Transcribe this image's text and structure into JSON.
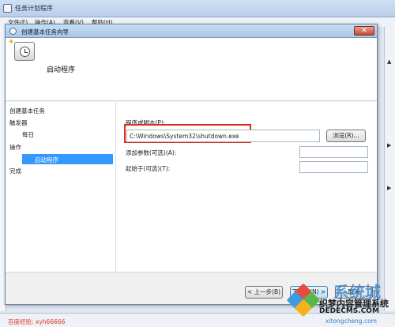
{
  "bg": {
    "title": "任务计划程序",
    "menu": [
      "文件(F)",
      "操作(A)",
      "查看(V)",
      "帮助(H)"
    ],
    "watermark_left": "百度经验: xyh66666"
  },
  "dialog": {
    "title": "创建基本任务向导",
    "close_label": "✕",
    "header_title": "启动程序",
    "nav": [
      {
        "label": "创建基本任务"
      },
      {
        "label": "触发器"
      },
      {
        "label": "每日"
      },
      {
        "label": "操作"
      },
      {
        "label": "启动程序",
        "selected": true
      },
      {
        "label": "完成"
      }
    ],
    "program_label": "程序或脚本(P):",
    "program_value": "C:\\Windows\\System32\\shutdown.exe",
    "browse_label": "浏览(R)...",
    "args_label": "添加参数(可选)(A):",
    "args_value": "",
    "startin_label": "起始于(可选)(T):",
    "startin_value": "",
    "back_label": "< 上一步(B)",
    "next_label": "下一步(N) >",
    "cancel_label": "取消"
  },
  "watermark": {
    "big": "系统城",
    "line1": "织梦内容管理系统",
    "line2": "DEDECMS.COM",
    "line3": "xitongcheng.com"
  },
  "colors": {
    "selection": "#3399ff",
    "highlight_box": "#e12b1e"
  }
}
